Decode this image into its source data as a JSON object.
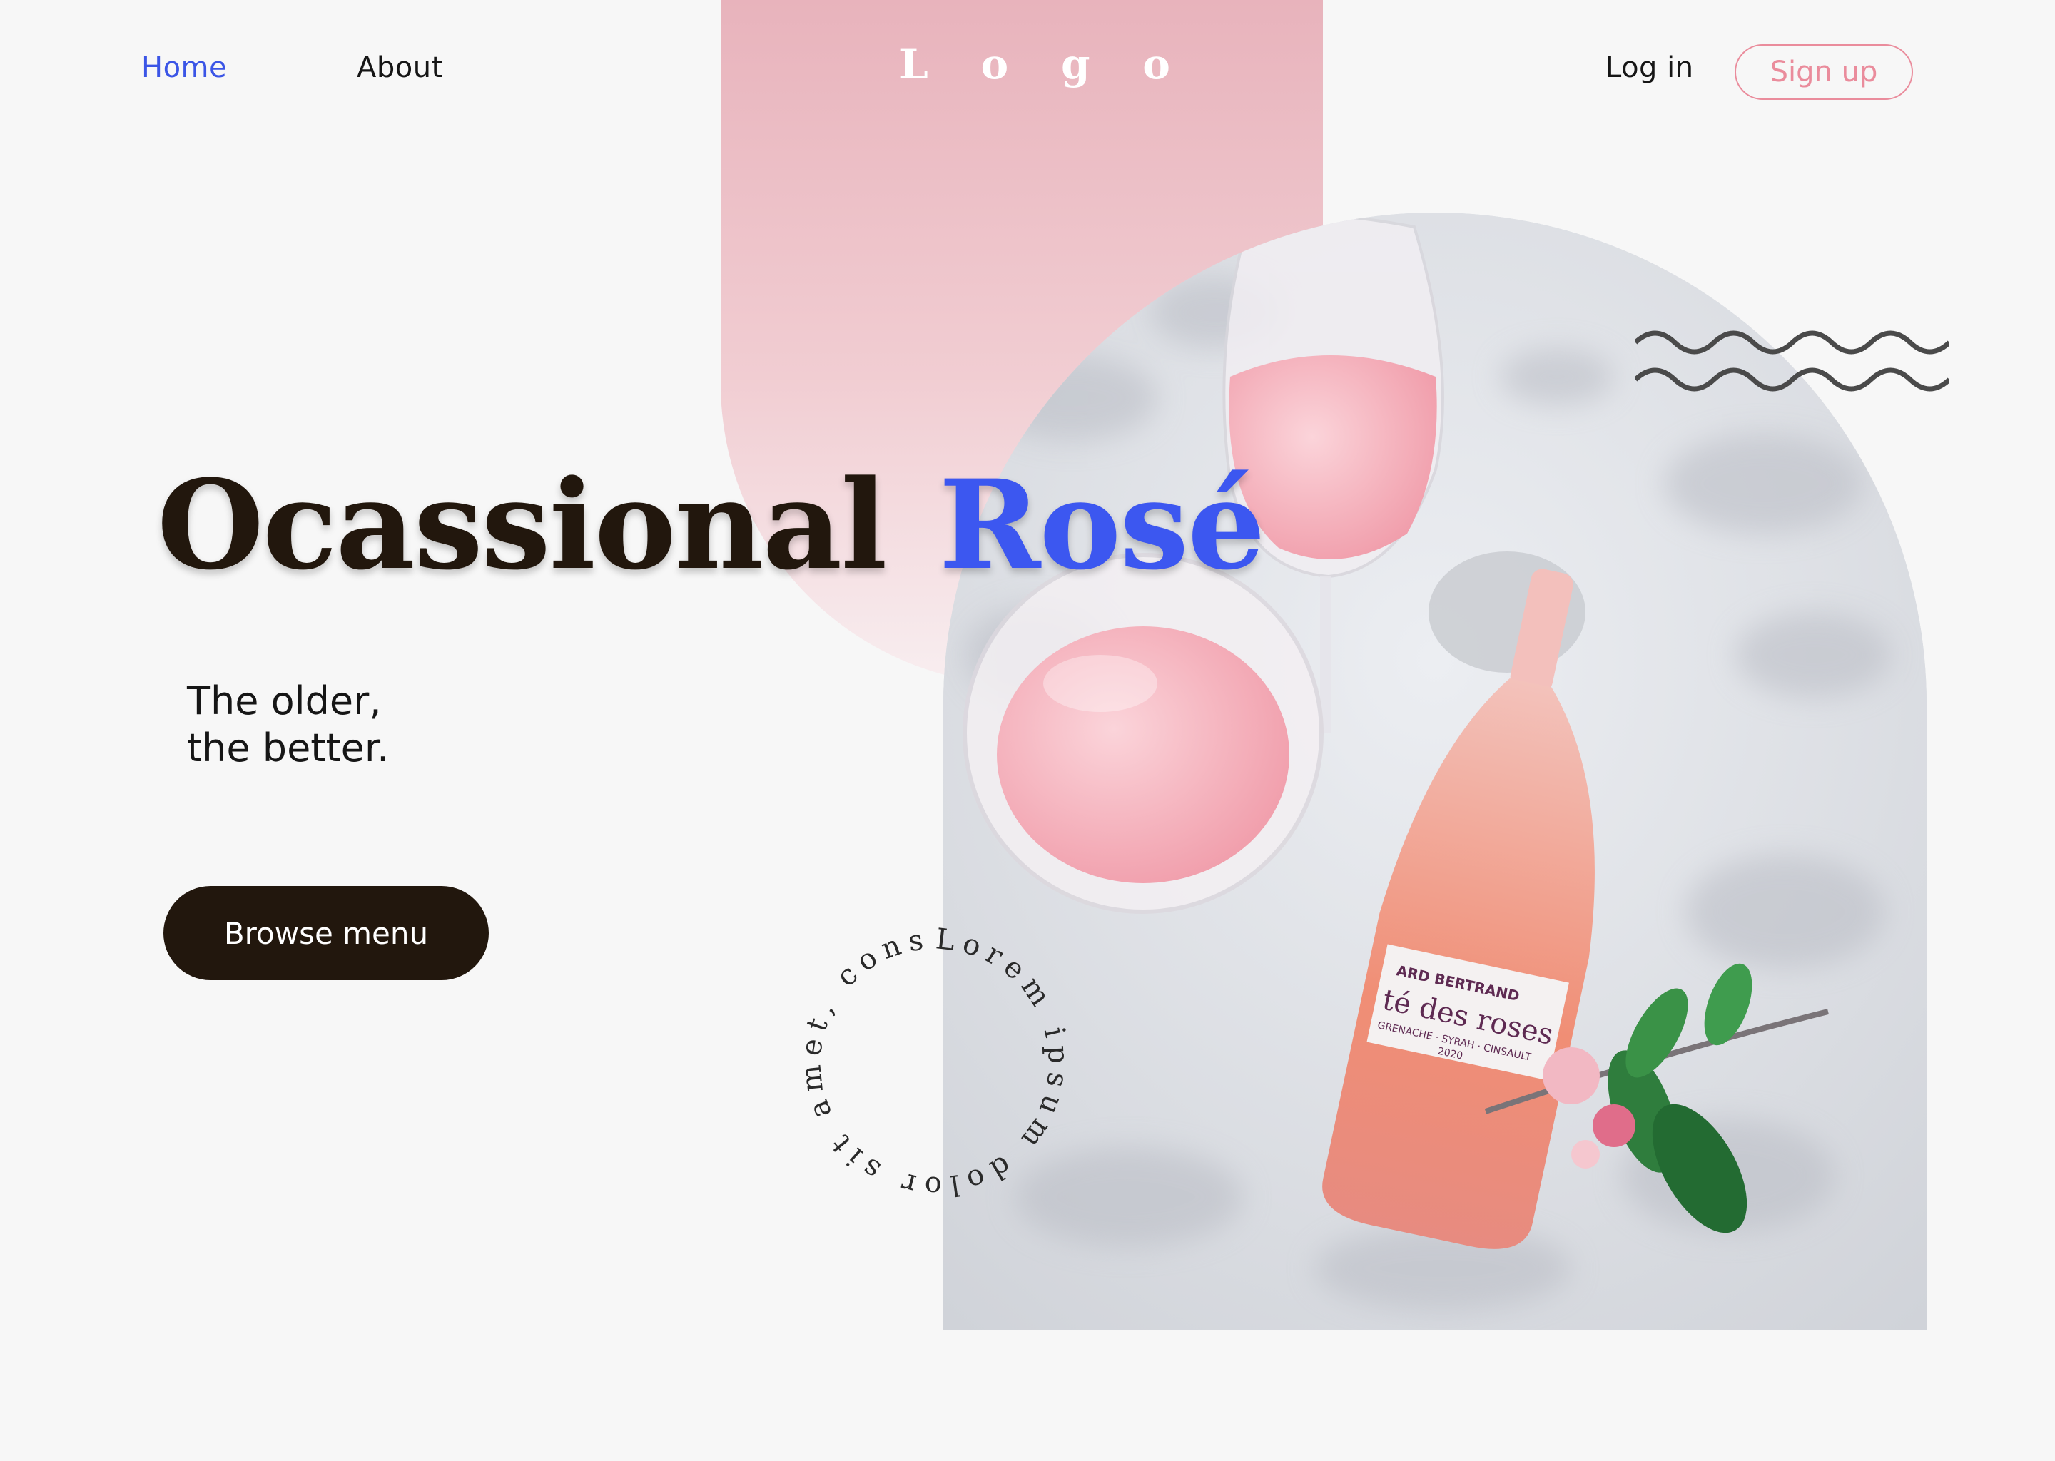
{
  "nav": {
    "home": "Home",
    "about": "About",
    "login": "Log in",
    "signup": "Sign up"
  },
  "logo": [
    "L",
    "o",
    "g",
    "o"
  ],
  "hero": {
    "title_part1": "Ocassional",
    "title_part2": "Rosé",
    "subtitle_line1": "The older,",
    "subtitle_line2": "the better.",
    "cta": "Browse menu"
  },
  "circle_text": "Lorem ipsum dolor sit amet, cons",
  "bottle_label": {
    "brand": "ARD BERTRAND",
    "name": "té des roses",
    "grapes": "GRENACHE · SYRAH · CINSAULT",
    "year": "2020"
  },
  "colors": {
    "accent_blue": "#3c57f0",
    "dark_brown": "#22170d",
    "pink": "#ea8c9c",
    "background": "#f7f7f7"
  }
}
